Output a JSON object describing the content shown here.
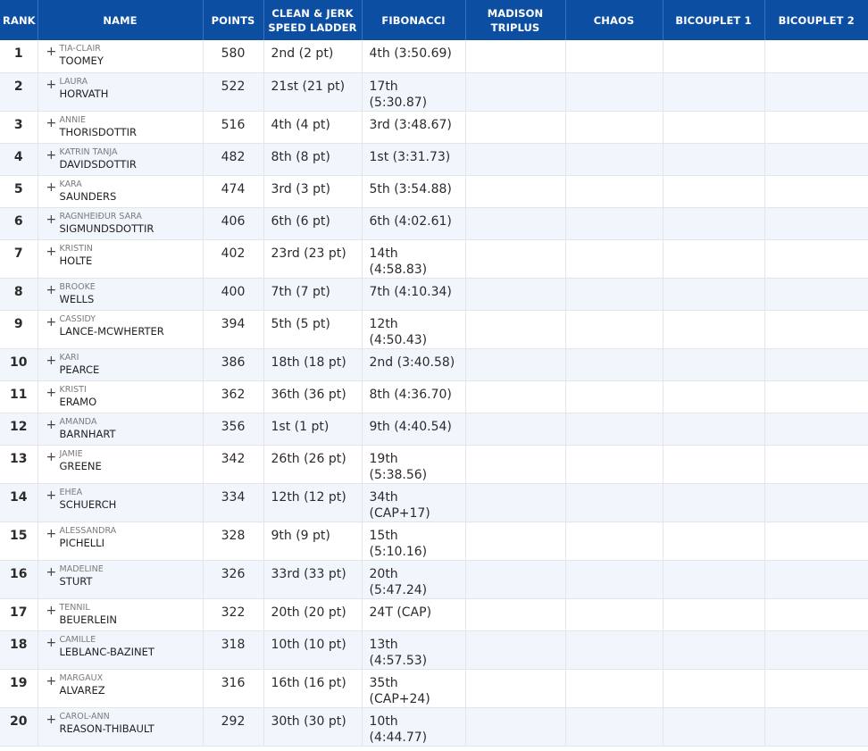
{
  "headers": {
    "rank": "RANK",
    "name": "NAME",
    "points": "POINTS",
    "ev1": "CLEAN & JERK SPEED LADDER",
    "ev2": "FIBONACCI",
    "ev3": "MADISON TRIPLUS",
    "ev4": "CHAOS",
    "ev5": "BICOUPLET 1",
    "ev6": "BICOUPLET 2"
  },
  "expand_symbol": "+",
  "rows": [
    {
      "rank": "1",
      "first": "TIA-CLAIR",
      "last": "TOOMEY",
      "points": "580",
      "ev1": "2nd (2 pt)",
      "ev2": "4th (3:50.69)"
    },
    {
      "rank": "2",
      "first": "LAURA",
      "last": "HORVATH",
      "points": "522",
      "ev1": "21st (21 pt)",
      "ev2": "17th (5:30.87)"
    },
    {
      "rank": "3",
      "first": "ANNIE",
      "last": "THORISDOTTIR",
      "points": "516",
      "ev1": "4th (4 pt)",
      "ev2": "3rd (3:48.67)"
    },
    {
      "rank": "4",
      "first": "KATRIN TANJA",
      "last": "DAVIDSDOTTIR",
      "points": "482",
      "ev1": "8th (8 pt)",
      "ev2": "1st (3:31.73)"
    },
    {
      "rank": "5",
      "first": "KARA",
      "last": "SAUNDERS",
      "points": "474",
      "ev1": "3rd (3 pt)",
      "ev2": "5th (3:54.88)"
    },
    {
      "rank": "6",
      "first": "RAGNHEIÐUR SARA",
      "last": "SIGMUNDSDOTTIR",
      "points": "406",
      "ev1": "6th (6 pt)",
      "ev2": "6th (4:02.61)"
    },
    {
      "rank": "7",
      "first": "KRISTIN",
      "last": "HOLTE",
      "points": "402",
      "ev1": "23rd (23 pt)",
      "ev2": "14th (4:58.83)"
    },
    {
      "rank": "8",
      "first": "BROOKE",
      "last": "WELLS",
      "points": "400",
      "ev1": "7th (7 pt)",
      "ev2": "7th (4:10.34)"
    },
    {
      "rank": "9",
      "first": "CASSIDY",
      "last": "LANCE-MCWHERTER",
      "points": "394",
      "ev1": "5th (5 pt)",
      "ev2": "12th (4:50.43)"
    },
    {
      "rank": "10",
      "first": "KARI",
      "last": "PEARCE",
      "points": "386",
      "ev1": "18th (18 pt)",
      "ev2": "2nd (3:40.58)"
    },
    {
      "rank": "11",
      "first": "KRISTI",
      "last": "ERAMO",
      "points": "362",
      "ev1": "36th (36 pt)",
      "ev2": "8th (4:36.70)"
    },
    {
      "rank": "12",
      "first": "AMANDA",
      "last": "BARNHART",
      "points": "356",
      "ev1": "1st (1 pt)",
      "ev2": "9th (4:40.54)"
    },
    {
      "rank": "13",
      "first": "JAMIE",
      "last": "GREENE",
      "points": "342",
      "ev1": "26th (26 pt)",
      "ev2": "19th (5:38.56)"
    },
    {
      "rank": "14",
      "first": "EHEA",
      "last": "SCHUERCH",
      "points": "334",
      "ev1": "12th (12 pt)",
      "ev2": "34th (CAP+17)"
    },
    {
      "rank": "15",
      "first": "ALESSANDRA",
      "last": "PICHELLI",
      "points": "328",
      "ev1": "9th (9 pt)",
      "ev2": "15th (5:10.16)"
    },
    {
      "rank": "16",
      "first": "MADELINE",
      "last": "STURT",
      "points": "326",
      "ev1": "33rd (33 pt)",
      "ev2": "20th (5:47.24)"
    },
    {
      "rank": "17",
      "first": "TENNIL",
      "last": "BEUERLEIN",
      "points": "322",
      "ev1": "20th (20 pt)",
      "ev2": "24T (CAP)"
    },
    {
      "rank": "18",
      "first": "CAMILLE",
      "last": "LEBLANC-BAZINET",
      "points": "318",
      "ev1": "10th (10 pt)",
      "ev2": "13th (4:57.53)"
    },
    {
      "rank": "19",
      "first": "MARGAUX",
      "last": "ALVAREZ",
      "points": "316",
      "ev1": "16th (16 pt)",
      "ev2": "35th (CAP+24)"
    },
    {
      "rank": "20",
      "first": "CAROL-ANN",
      "last": "REASON-THIBAULT",
      "points": "292",
      "ev1": "30th (30 pt)",
      "ev2": "10th (4:44.77)"
    }
  ]
}
